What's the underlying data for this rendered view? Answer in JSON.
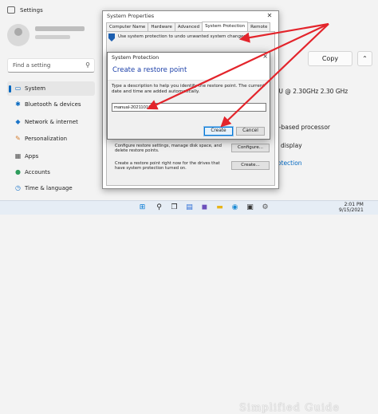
{
  "settings": {
    "title": "Settings",
    "search_placeholder": "Find a setting",
    "nav": [
      {
        "label": "System",
        "icon": "system-icon"
      },
      {
        "label": "Bluetooth & devices",
        "icon": "bluetooth-icon"
      },
      {
        "label": "Network & internet",
        "icon": "network-icon"
      },
      {
        "label": "Personalization",
        "icon": "brush-icon"
      },
      {
        "label": "Apps",
        "icon": "apps-icon"
      },
      {
        "label": "Accounts",
        "icon": "accounts-icon"
      },
      {
        "label": "Time & language",
        "icon": "clock-icon"
      }
    ],
    "copy_label": "Copy",
    "cpu_text": "PU @ 2.30GHz   2.30 GHz",
    "processor_text": "4-based processor",
    "display_text": "e display",
    "protection_link": "rotection"
  },
  "system_properties": {
    "title": "System Properties",
    "tabs": [
      "Computer Name",
      "Hardware",
      "Advanced",
      "System Protection",
      "Remote"
    ],
    "active_tab": "System Protection",
    "description": "Use system protection to undo unwanted system changes.",
    "configure_text": "Configure restore settings, manage disk space, and delete restore points.",
    "configure_label": "Configure...",
    "create_text": "Create a restore point right now for the drives that have system protection turned on.",
    "create_label": "Create..."
  },
  "system_protection_dialog": {
    "title": "System Protection",
    "header": "Create a restore point",
    "description": "Type a description to help you identify the restore point. The current date and time are added automatically.",
    "restore_name": "manual-20211010",
    "create_label": "Create",
    "cancel_label": "Cancel",
    "close_label": "×"
  },
  "taskbar": {
    "time": "2:01 PM",
    "date": "9/15/2021",
    "watermark": "Simplified Guide"
  },
  "colors": {
    "accent": "#0067c0",
    "arrow": "#e3242b",
    "header_blue": "#1a3ea8"
  }
}
